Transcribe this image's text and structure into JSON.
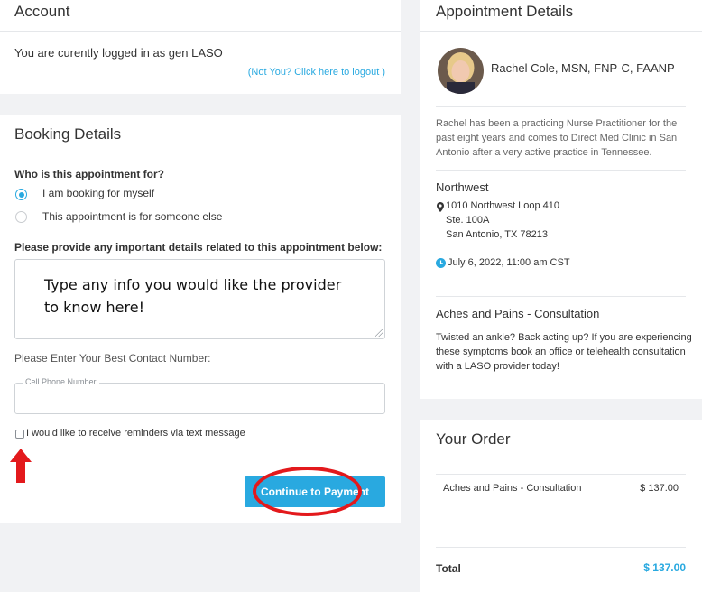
{
  "account": {
    "title": "Account",
    "logged_in_text": "You are curently logged in as gen LASO",
    "logout_link": "(Not You? Click here to logout )"
  },
  "booking": {
    "title": "Booking Details",
    "who_question": "Who is this appointment for?",
    "option_self": "I am booking for myself",
    "option_other": "This appointment is for someone else",
    "details_prompt": "Please provide any important details related to this appointment below:",
    "notes_overlay_line1": "Type any info you would like the provider",
    "notes_overlay_line2": "to know here!",
    "contact_prompt": "Please Enter Your Best Contact Number:",
    "phone_placeholder": "Cell Phone Number",
    "reminder_label": "I would like to receive reminders via text message",
    "continue_button": "Continue to Payment"
  },
  "appointment": {
    "title": "Appointment Details",
    "provider_name": "Rachel Cole, MSN, FNP-C, FAANP",
    "bio_line1": "Rachel has been a practicing Nurse Practitioner for the",
    "bio_line2": "past eight years and comes to Direct Med Clinic in San",
    "bio_line3": "Antonio after a very active practice in Tennessee.",
    "location_name": "Northwest",
    "address_line1": "1010 Northwest Loop 410",
    "address_line2": "Ste. 100A",
    "address_line3": "San Antonio, TX 78213",
    "datetime": "July 6, 2022, 11:00 am CST",
    "service_name": "Aches and Pains - Consultation",
    "service_desc_line1": "Twisted an ankle? Back acting up? If you are experiencing",
    "service_desc_line2": "these symptoms book an office or telehealth consultation",
    "service_desc_line3": "with a LASO provider today!"
  },
  "order": {
    "title": "Your Order",
    "items": [
      {
        "name": "Aches and Pains - Consultation",
        "price": "$ 137.00"
      }
    ],
    "total_label": "Total",
    "total_value": "$ 137.00"
  },
  "colors": {
    "accent": "#29a9e0",
    "annotation_red": "#e3191c"
  }
}
